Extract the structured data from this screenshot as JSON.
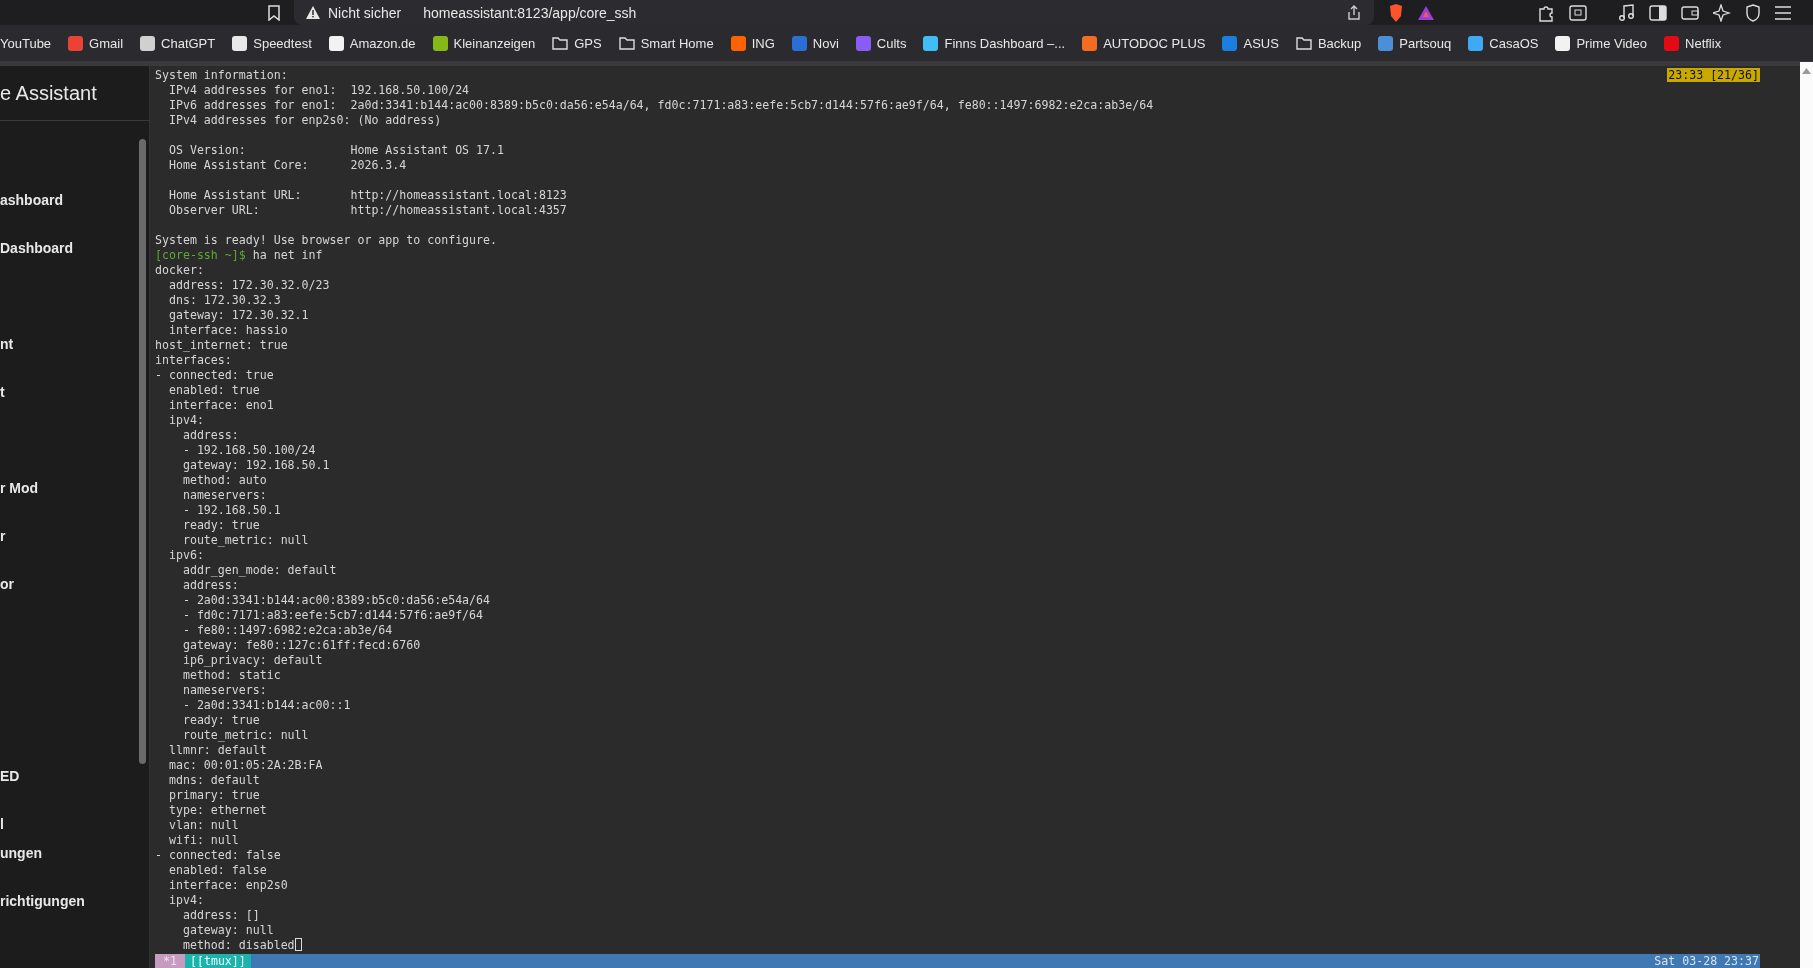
{
  "browser": {
    "security_label": "Nicht sicher",
    "url": "homeassistant:8123/app/core_ssh"
  },
  "bookmarks": [
    {
      "label": "YouTube",
      "kind": "text"
    },
    {
      "label": "Gmail",
      "kind": "site",
      "color": "#ea4335"
    },
    {
      "label": "ChatGPT",
      "kind": "site",
      "color": "#d0d0d0"
    },
    {
      "label": "Speedtest",
      "kind": "site",
      "color": "#e8e8e8"
    },
    {
      "label": "Amazon.de",
      "kind": "site",
      "color": "#f2f2f2"
    },
    {
      "label": "Kleinanzeigen",
      "kind": "site",
      "color": "#86b817"
    },
    {
      "label": "GPS",
      "kind": "folder"
    },
    {
      "label": "Smart Home",
      "kind": "folder"
    },
    {
      "label": "ING",
      "kind": "site",
      "color": "#ff6200"
    },
    {
      "label": "Novi",
      "kind": "site",
      "color": "#2a6fd6"
    },
    {
      "label": "Cults",
      "kind": "site",
      "color": "#8a5cf6"
    },
    {
      "label": "Finns Dashboard –...",
      "kind": "site",
      "color": "#41bdf5"
    },
    {
      "label": "AUTODOC PLUS",
      "kind": "site",
      "color": "#f36c21"
    },
    {
      "label": "ASUS",
      "kind": "site",
      "color": "#1a7fe0"
    },
    {
      "label": "Backup",
      "kind": "folder"
    },
    {
      "label": "Partsouq",
      "kind": "site",
      "color": "#4a90d9"
    },
    {
      "label": "CasaOS",
      "kind": "site",
      "color": "#3fa9f5"
    },
    {
      "label": "Prime Video",
      "kind": "site",
      "color": "#f2f2f2"
    },
    {
      "label": "Netflix",
      "kind": "site",
      "color": "#e50914"
    }
  ],
  "sidebar": {
    "title": "e Assistant",
    "items": [
      {
        "label": "ashboard"
      },
      {
        "label": "Dashboard"
      },
      {
        "label": "nt"
      },
      {
        "label": "t"
      },
      {
        "label": "r Mod"
      },
      {
        "label": "r"
      },
      {
        "label": "or"
      },
      {
        "label": "ED"
      },
      {
        "label": "l"
      }
    ],
    "footer_items": [
      {
        "label": "ungen"
      },
      {
        "label": "richtigungen"
      }
    ]
  },
  "terminal": {
    "pane_position": "23:33 [21/36]",
    "lines": [
      {
        "kind": "output",
        "text": "System information:"
      },
      {
        "kind": "output",
        "text": "  IPv4 addresses for eno1:  192.168.50.100/24"
      },
      {
        "kind": "output",
        "text": "  IPv6 addresses for eno1:  2a0d:3341:b144:ac00:8389:b5c0:da56:e54a/64, fd0c:7171:a83:eefe:5cb7:d144:57f6:ae9f/64, fe80::1497:6982:e2ca:ab3e/64"
      },
      {
        "kind": "output",
        "text": "  IPv4 addresses for enp2s0: (No address)"
      },
      {
        "kind": "blank"
      },
      {
        "kind": "output",
        "text": "  OS Version:               Home Assistant OS 17.1"
      },
      {
        "kind": "output",
        "text": "  Home Assistant Core:      2026.3.4"
      },
      {
        "kind": "blank"
      },
      {
        "kind": "output",
        "text": "  Home Assistant URL:       http://homeassistant.local:8123"
      },
      {
        "kind": "output",
        "text": "  Observer URL:             http://homeassistant.local:4357"
      },
      {
        "kind": "blank"
      },
      {
        "kind": "output",
        "text": "System is ready! Use browser or app to configure."
      },
      {
        "kind": "prompt",
        "prompt": "[core-ssh ~]$",
        "text": " ha net inf"
      },
      {
        "kind": "output",
        "text": "docker:"
      },
      {
        "kind": "output",
        "text": "  address: 172.30.32.0/23"
      },
      {
        "kind": "output",
        "text": "  dns: 172.30.32.3"
      },
      {
        "kind": "output",
        "text": "  gateway: 172.30.32.1"
      },
      {
        "kind": "output",
        "text": "  interface: hassio"
      },
      {
        "kind": "output",
        "text": "host_internet: true"
      },
      {
        "kind": "output",
        "text": "interfaces:"
      },
      {
        "kind": "output",
        "text": "- connected: true"
      },
      {
        "kind": "output",
        "text": "  enabled: true"
      },
      {
        "kind": "output",
        "text": "  interface: eno1"
      },
      {
        "kind": "output",
        "text": "  ipv4:"
      },
      {
        "kind": "output",
        "text": "    address:"
      },
      {
        "kind": "output",
        "text": "    - 192.168.50.100/24"
      },
      {
        "kind": "output",
        "text": "    gateway: 192.168.50.1"
      },
      {
        "kind": "output",
        "text": "    method: auto"
      },
      {
        "kind": "output",
        "text": "    nameservers:"
      },
      {
        "kind": "output",
        "text": "    - 192.168.50.1"
      },
      {
        "kind": "output",
        "text": "    ready: true"
      },
      {
        "kind": "output",
        "text": "    route_metric: null"
      },
      {
        "kind": "output",
        "text": "  ipv6:"
      },
      {
        "kind": "output",
        "text": "    addr_gen_mode: default"
      },
      {
        "kind": "output",
        "text": "    address:"
      },
      {
        "kind": "output",
        "text": "    - 2a0d:3341:b144:ac00:8389:b5c0:da56:e54a/64"
      },
      {
        "kind": "output",
        "text": "    - fd0c:7171:a83:eefe:5cb7:d144:57f6:ae9f/64"
      },
      {
        "kind": "output",
        "text": "    - fe80::1497:6982:e2ca:ab3e/64"
      },
      {
        "kind": "output",
        "text": "    gateway: fe80::127c:61ff:fecd:6760"
      },
      {
        "kind": "output",
        "text": "    ip6_privacy: default"
      },
      {
        "kind": "output",
        "text": "    method: static"
      },
      {
        "kind": "output",
        "text": "    nameservers:"
      },
      {
        "kind": "output",
        "text": "    - 2a0d:3341:b144:ac00::1"
      },
      {
        "kind": "output",
        "text": "    ready: true"
      },
      {
        "kind": "output",
        "text": "    route_metric: null"
      },
      {
        "kind": "output",
        "text": "  llmnr: default"
      },
      {
        "kind": "output",
        "text": "  mac: 00:01:05:2A:2B:FA"
      },
      {
        "kind": "output",
        "text": "  mdns: default"
      },
      {
        "kind": "output",
        "text": "  primary: true"
      },
      {
        "kind": "output",
        "text": "  type: ethernet"
      },
      {
        "kind": "output",
        "text": "  vlan: null"
      },
      {
        "kind": "output",
        "text": "  wifi: null"
      },
      {
        "kind": "output",
        "text": "- connected: false"
      },
      {
        "kind": "output",
        "text": "  enabled: false"
      },
      {
        "kind": "output",
        "text": "  interface: enp2s0"
      },
      {
        "kind": "output",
        "text": "  ipv4:"
      },
      {
        "kind": "output",
        "text": "    address: []"
      },
      {
        "kind": "output",
        "text": "    gateway: null"
      },
      {
        "kind": "output",
        "text": "    method: disabled",
        "cursor": true
      }
    ],
    "status_bar": {
      "session": "*1",
      "window": "[[tmux]]",
      "clock": "Sat 03-28 23:37"
    }
  }
}
